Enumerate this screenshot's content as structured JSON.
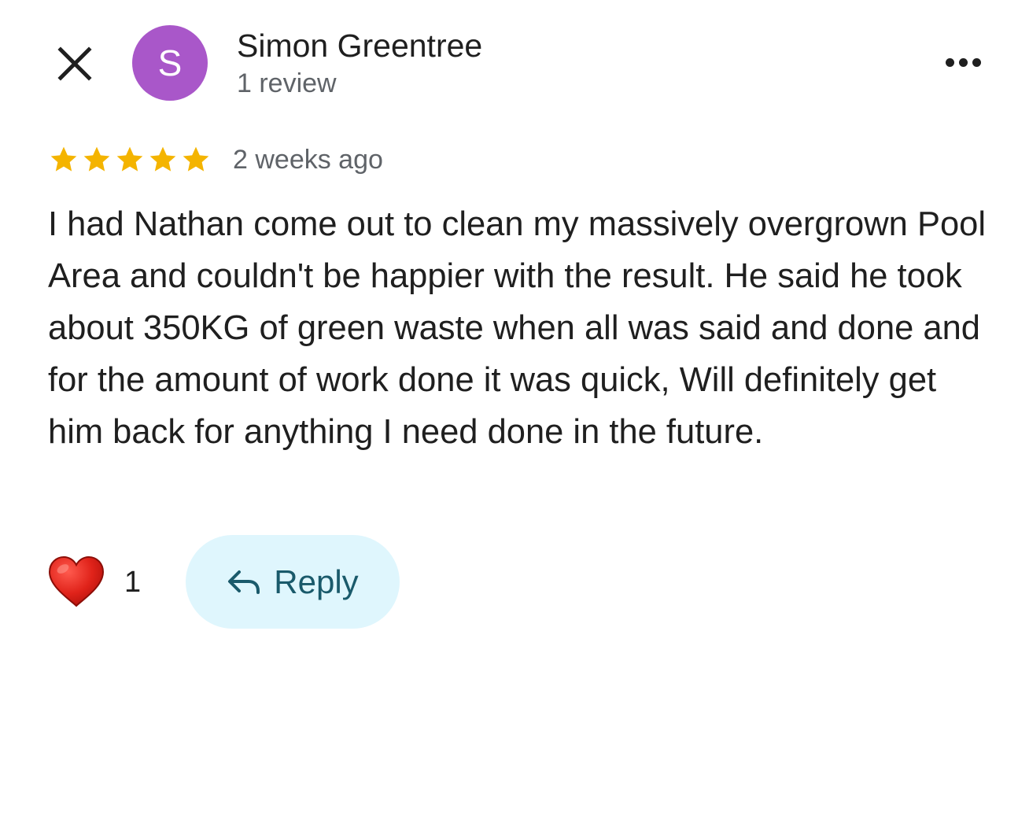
{
  "header": {
    "close_icon": "close-icon",
    "avatar_letter": "S",
    "avatar_color": "#a957c9",
    "user_name": "Simon Greentree",
    "review_count": "1 review",
    "more_icon": "more-horizontal-icon"
  },
  "review": {
    "rating": 5,
    "rating_max": 5,
    "star_color": "#f4b400",
    "time_ago": "2 weeks ago",
    "text": "I had Nathan come out to clean my massively overgrown Pool Area and couldn't be happier with the result. He said he took about 350KG of green waste when all was said and done and for the amount of work done it was quick, Will definitely get him back for anything I need done in the future."
  },
  "actions": {
    "like_icon": "heart-icon",
    "like_count": "1",
    "reply_icon": "reply-arrow-icon",
    "reply_label": "Reply",
    "reply_bg": "#dff6fd"
  }
}
